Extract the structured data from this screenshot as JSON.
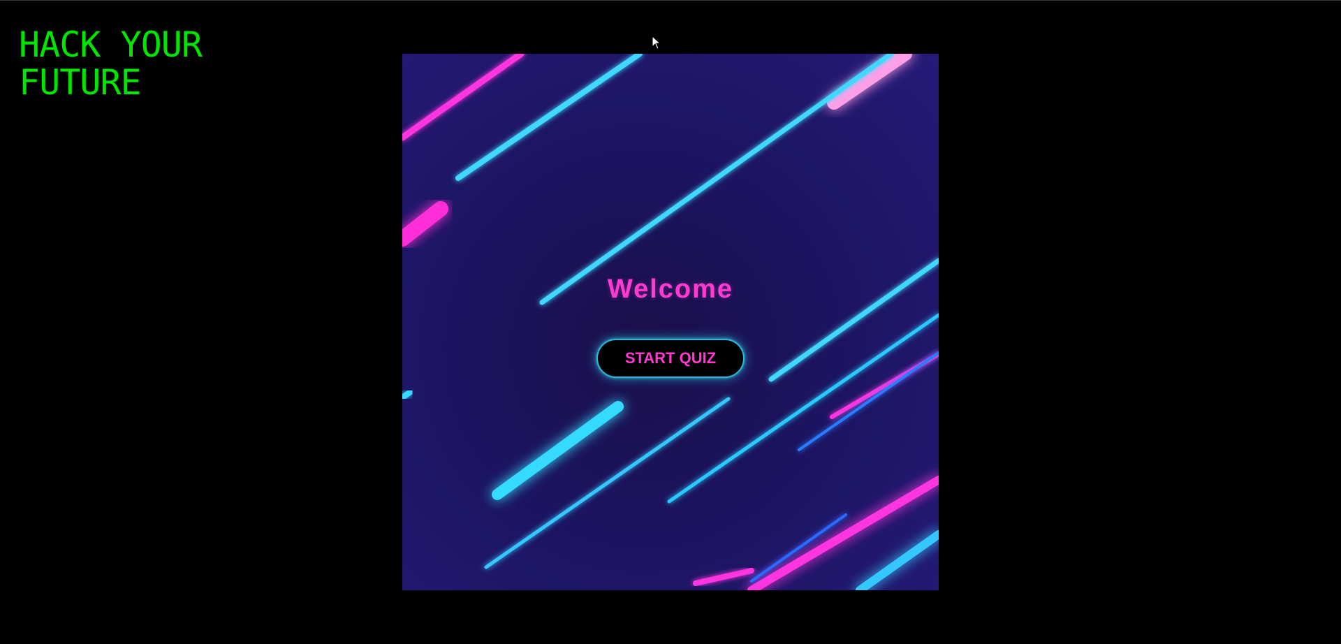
{
  "header": {
    "logo_text": "HACK YOUR\nFUTURE",
    "logo_color": "#00e600"
  },
  "hero": {
    "welcome_text": "Welcome",
    "start_button_label": "START QUIZ",
    "accent_pink": "#ff3ad0",
    "accent_cyan": "#2bb7d8",
    "background": "neon-streaks"
  }
}
